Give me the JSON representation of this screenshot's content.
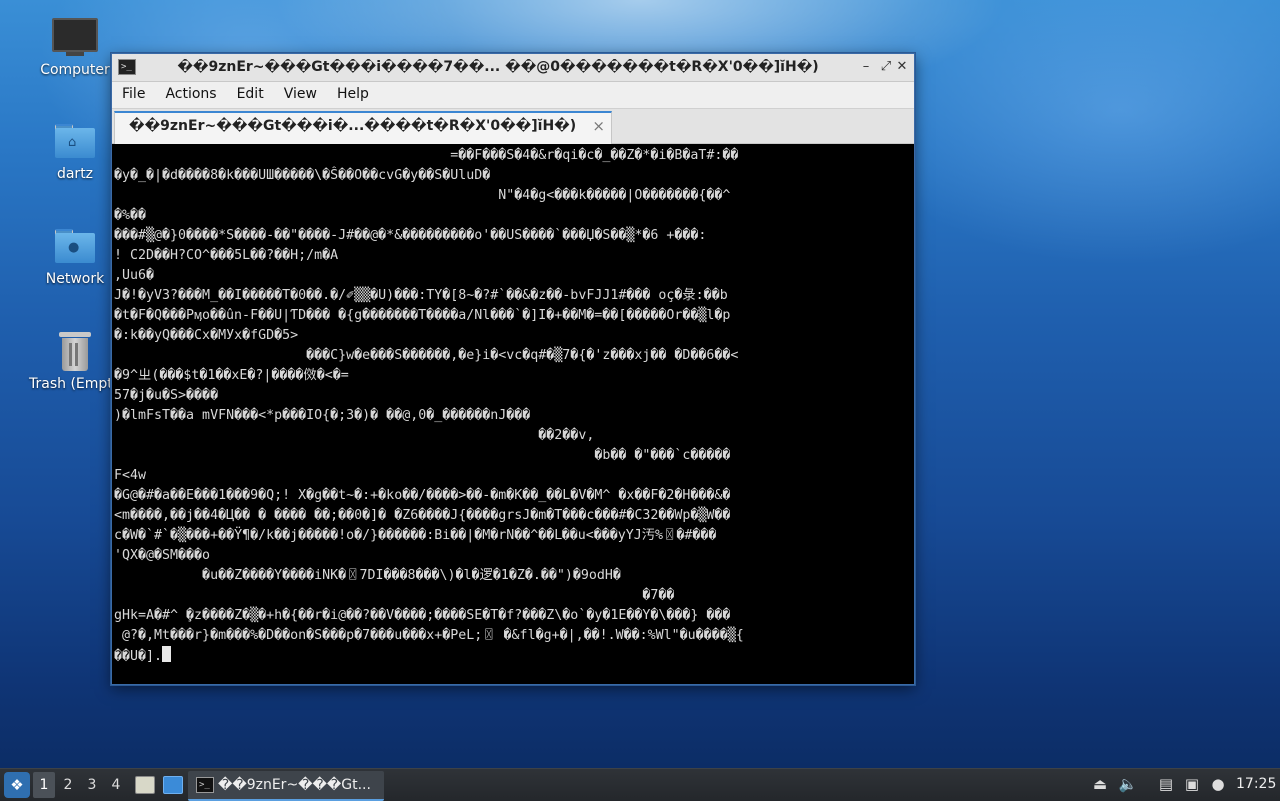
{
  "desktop": {
    "icons": [
      {
        "label": "Computer"
      },
      {
        "label": "dartz"
      },
      {
        "label": "Network"
      },
      {
        "label": "Trash (Empt"
      }
    ]
  },
  "window": {
    "title": "��9znEr~���Gt���i����7��... ��@0�������t�R�X'0��]ĭH�)",
    "menu": [
      "File",
      "Actions",
      "Edit",
      "View",
      "Help"
    ],
    "tab_title": "��9znEr~���Gt���i�...����t�R�X'0��]ĭH�)",
    "tab_close": "×",
    "terminal_lines": [
      "                                          =��F���S�4�&r�qi�c�_��Z�*�i�B�aT#:��",
      "�y�_�|�d����8�k���UШ�����\\�Ŝ��O��cvG�y��S�UluD�",
      "                                                N\"�4�g<���k�����|O�������{��^",
      "�%��",
      "���#▒@�}0����*S����-��\"����-J#��@�*&���������o'��US����`���Џ�S��▒*�6 +���:",
      "! C2D��H?CO^���5L��?��H;/m�A",
      ",Uu6�",
      "J�!�yV3?���M_��I�����T�0��.�/✐▒▒�U)���:TY�[8~�?#`��&�z��-bvFJJ1#��� oç�彔:��b",
      "�t�F�Q���Pӎo��ûn-F��U|ƬD��� �{g�������T����a/Nl���`�]I�+��M�=��[�����Or��▒l�p",
      "�:k��yQ���Cx�MУх�fGD�5>",
      "                        ���C}w�e���S������,�e}i�<vc�q#�▒7�{�'z���xj�� �D��6��<",
      "�9^ㄓ(���$t�1��xE�?|����傚�<�=",
      "57�j�u�S>����",
      ")�lmFsT��a mVFN���<*p���IO{�;3�)� ��@,0�_������nJ���",
      "                                                     ��2��v,",
      "                                                            �b�� �\"���`c�����",
      "F<4w",
      "�G@�#�a��E���1���9�Q;! X�g��t~�:+�ko��/����>��-�m�K��_��L�V�M^ �x��F�2�H���&�",
      "<m����,��j��4�Ц�� � ���� ��;��0�]� �Z6����J{����grsJ�m�T���c���#�C32��Wp�▒W��",
      "c�W�`#`�▒���+��Ÿ¶�/k��j�����!o�/}������:Bi��|�M�rN��^��ᒪ��u<���yYJ汚%〿�#���",
      "'QX�@�SM���o",
      "           �u��Z����Y����iNK�〿7DI���8���\\)�l�逻�1�Z�.��\")�9odH�",
      "                                                                  �7��",
      "gHk=A�#^ ̧�z����Z�▒�+h�{��r�i@��?��V����;����SE�T�f?���Z\\�o`�y�1E��Y�\\���} ���",
      " @?�,Mt���r}�m���%�D��on�S���p�7���u���x+�PeL;〿 �&fl�g+�|,��!.W��:%Wl\"�u����▒{",
      "��U�]."
    ]
  },
  "taskbar": {
    "workspaces": [
      "1",
      "2",
      "3",
      "4"
    ],
    "task_label": "��9znEr~���Gt...",
    "clock": "17:25"
  }
}
